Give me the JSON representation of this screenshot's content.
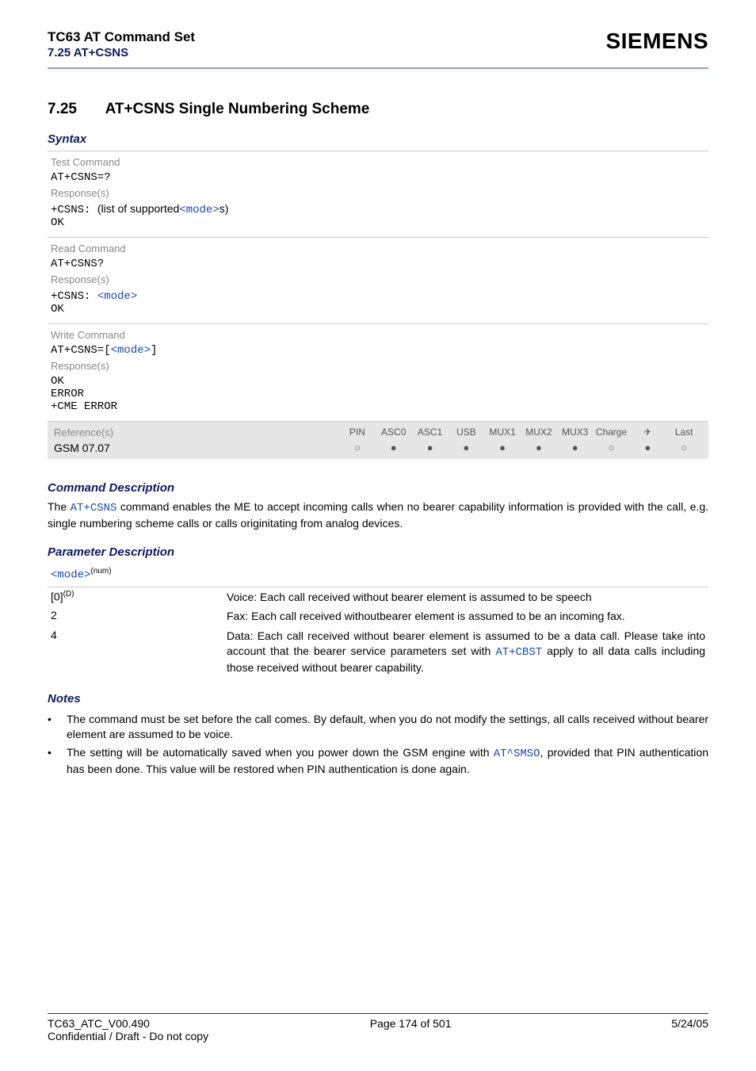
{
  "header": {
    "doc_title": "TC63 AT Command Set",
    "doc_section": "7.25 AT+CSNS",
    "brand": "SIEMENS"
  },
  "section": {
    "number": "7.25",
    "title": "AT+CSNS   Single Numbering Scheme"
  },
  "syntax_label": "Syntax",
  "blocks": {
    "test": {
      "label": "Test Command",
      "cmd": "AT+CSNS=?",
      "resp_label": "Response(s)",
      "resp_prefix": "+CSNS: ",
      "resp_text1": "(list of supported",
      "resp_mode": "<mode>",
      "resp_text2": "s)",
      "ok": "OK"
    },
    "read": {
      "label": "Read Command",
      "cmd": "AT+CSNS?",
      "resp_label": "Response(s)",
      "resp_prefix": "+CSNS: ",
      "resp_mode": "<mode>",
      "ok": "OK"
    },
    "write": {
      "label": "Write Command",
      "cmd_prefix": "AT+CSNS=[",
      "cmd_mode": "<mode>",
      "cmd_suffix": "]",
      "resp_label": "Response(s)",
      "ok": "OK",
      "error": "ERROR",
      "cme": "+CME ERROR"
    }
  },
  "reference": {
    "label": "Reference(s)",
    "value": "GSM 07.07",
    "columns": [
      "PIN",
      "ASC0",
      "ASC1",
      "USB",
      "MUX1",
      "MUX2",
      "MUX3",
      "Charge",
      "✈",
      "Last"
    ],
    "states": [
      "open",
      "filled",
      "filled",
      "filled",
      "filled",
      "filled",
      "filled",
      "open",
      "filled",
      "open"
    ]
  },
  "command_desc": {
    "heading": "Command Description",
    "text_pre": "The ",
    "cmd": "AT+CSNS",
    "text_post": " command enables the ME to accept incoming calls when no bearer capability information is provided with the call, e.g. single numbering scheme calls or calls originitating from analog devices."
  },
  "param_desc": {
    "heading": "Parameter Description",
    "param_name": "<mode>",
    "param_sup": "(num)",
    "rows": [
      {
        "key": "[0]",
        "key_sup": "(D)",
        "desc": "Voice: Each call received without bearer element is assumed to be speech"
      },
      {
        "key": "2",
        "key_sup": "",
        "desc": "Fax: Each call received withoutbearer element is assumed to be an incoming fax."
      },
      {
        "key": "4",
        "key_sup": "",
        "desc_pre": "Data: Each call received without bearer element is assumed to be a data call. Please take into account that the bearer service parameters set with ",
        "desc_cmd": "AT+CBST",
        "desc_post": " apply to all data calls including those received without bearer capability."
      }
    ]
  },
  "notes": {
    "heading": "Notes",
    "items": [
      {
        "text": "The command must be set before the call comes. By default, when you do not modify the settings, all calls received without bearer element are assumed to be voice."
      },
      {
        "text_pre": "The setting will be automatically saved when you power down the GSM engine with ",
        "cmd": "AT^SMSO",
        "text_post": ", provided that PIN authentication has been done. This value will be restored when PIN authentication is done again."
      }
    ]
  },
  "footer": {
    "left": "TC63_ATC_V00.490",
    "center": "Page 174 of 501",
    "right": "5/24/05",
    "sub": "Confidential / Draft - Do not copy"
  }
}
